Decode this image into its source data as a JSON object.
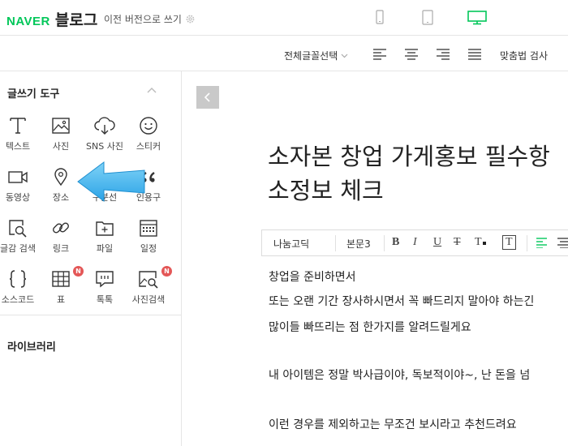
{
  "header": {
    "brand": "NAVER",
    "product": "블로그",
    "previous_version_label": "이전 버전으로 쓰기",
    "device_modes": [
      "mobile-icon",
      "tablet-icon",
      "pc-monitor-icon"
    ],
    "active_device": "pc-monitor-icon",
    "accent_color": "#03c75a"
  },
  "format_bar": {
    "font_select_label": "전체글꼴선택",
    "align_buttons": [
      "align-left-icon",
      "align-center-icon",
      "align-right-icon",
      "align-justify-icon"
    ],
    "spell_check_label": "맞춤법 검사"
  },
  "writing_tools": {
    "title": "글쓰기 도구",
    "items": [
      {
        "label": "텍스트",
        "icon": "text-icon"
      },
      {
        "label": "사진",
        "icon": "photo-icon"
      },
      {
        "label": "SNS 사진",
        "icon": "cloud-download-icon"
      },
      {
        "label": "스티커",
        "icon": "smiley-icon"
      },
      {
        "label": "동영상",
        "icon": "video-icon"
      },
      {
        "label": "장소",
        "icon": "map-pin-icon"
      },
      {
        "label": "구분선",
        "icon": "divider-icon"
      },
      {
        "label": "인용구",
        "icon": "quote-icon"
      },
      {
        "label": "글감 검색",
        "icon": "content-search-icon"
      },
      {
        "label": "링크",
        "icon": "link-icon"
      },
      {
        "label": "파일",
        "icon": "file-add-icon"
      },
      {
        "label": "일정",
        "icon": "calendar-icon"
      },
      {
        "label": "소스코드",
        "icon": "code-braces-icon"
      },
      {
        "label": "표",
        "icon": "table-icon"
      },
      {
        "label": "톡톡",
        "icon": "chat-icon"
      },
      {
        "label": "사진검색",
        "icon": "photo-search-icon"
      }
    ],
    "new_badge": "N"
  },
  "library": {
    "title": "라이브러리"
  },
  "editor": {
    "title_line1": "소자본 창업 가게홍보 필수항",
    "title_line2": "소정보 체크",
    "toolbar": {
      "font": "나눔고딕",
      "size": "본문3",
      "bold": "B",
      "italic": "I",
      "underline": "U",
      "strike": "T",
      "font_color": "T",
      "bg_color": "T"
    },
    "paragraphs": [
      "창업을 준비하면서",
      "또는 오랜 기간 장사하시면서 꼭 빠드리지 말아야 하는긴",
      "많이들 빠뜨리는 점 한가지를 알려드릴게요",
      "내 아이템은 정말 박사급이야, 독보적이야~, 난 돈을 넘",
      "이런 경우를 제외하고는 무조건 보시라고 추천드려요"
    ]
  }
}
